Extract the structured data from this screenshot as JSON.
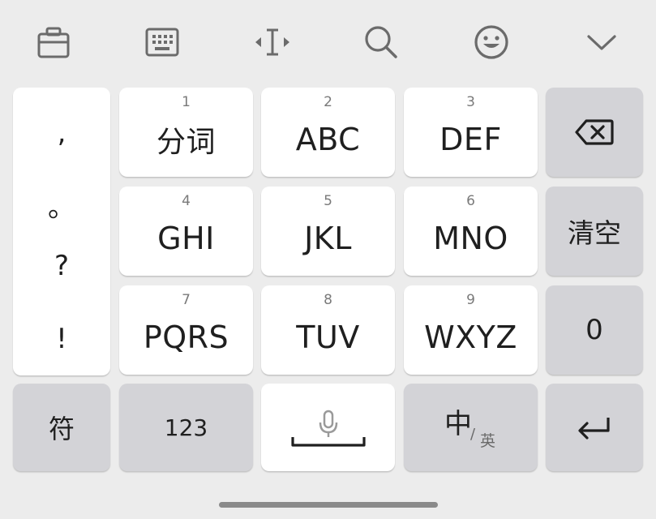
{
  "toolbar": {
    "icons": [
      "clipboard-icon",
      "keyboard-icon",
      "cursor-move-icon",
      "search-icon",
      "emoji-icon",
      "collapse-chevron-icon"
    ]
  },
  "punctuation": [
    ",",
    "。",
    "?",
    "!"
  ],
  "keys": {
    "row1": [
      {
        "num": "1",
        "label": "分词"
      },
      {
        "num": "2",
        "label": "ABC"
      },
      {
        "num": "3",
        "label": "DEF"
      }
    ],
    "row2": [
      {
        "num": "4",
        "label": "GHI"
      },
      {
        "num": "5",
        "label": "JKL"
      },
      {
        "num": "6",
        "label": "MNO"
      }
    ],
    "row3": [
      {
        "num": "7",
        "label": "PQRS"
      },
      {
        "num": "8",
        "label": "TUV"
      },
      {
        "num": "9",
        "label": "WXYZ"
      }
    ]
  },
  "side": {
    "clear": "清空",
    "zero": "0"
  },
  "bottom": {
    "symbols": "符",
    "numbers": "123",
    "lang_cn": "中",
    "lang_slash": "/",
    "lang_en": "英"
  },
  "colors": {
    "background": "#ececec",
    "key_white": "#ffffff",
    "key_gray": "#d3d3d7",
    "icon": "#6b6b6b",
    "text": "#1f1f1f"
  }
}
